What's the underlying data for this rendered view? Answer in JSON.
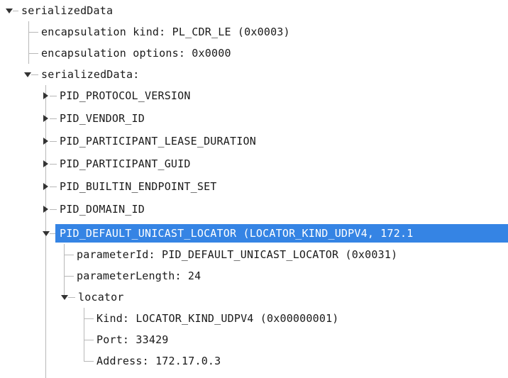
{
  "tree": {
    "root_label": "serializedData",
    "encapsulation_kind": "encapsulation kind: PL_CDR_LE (0x0003)",
    "encapsulation_options": "encapsulation options: 0x0000",
    "serialized_data_label": "serializedData:",
    "pids": [
      "PID_PROTOCOL_VERSION",
      "PID_VENDOR_ID",
      "PID_PARTICIPANT_LEASE_DURATION",
      "PID_PARTICIPANT_GUID",
      "PID_BUILTIN_ENDPOINT_SET",
      "PID_DOMAIN_ID"
    ],
    "selected": {
      "label": "PID_DEFAULT_UNICAST_LOCATOR (LOCATOR_KIND_UDPV4, 172.1",
      "parameter_id": "parameterId: PID_DEFAULT_UNICAST_LOCATOR (0x0031)",
      "parameter_length": "parameterLength: 24",
      "locator": {
        "label": "locator",
        "kind": "Kind: LOCATOR_KIND_UDPV4 (0x00000001)",
        "port": "Port: 33429",
        "address": "Address: 172.17.0.3"
      }
    }
  },
  "colors": {
    "selection": "#3584e4",
    "tree_lines": "#b8b8b8",
    "text": "#1a1a1a"
  },
  "icons": {
    "expanded": "expander-down-icon",
    "collapsed": "expander-right-icon"
  }
}
